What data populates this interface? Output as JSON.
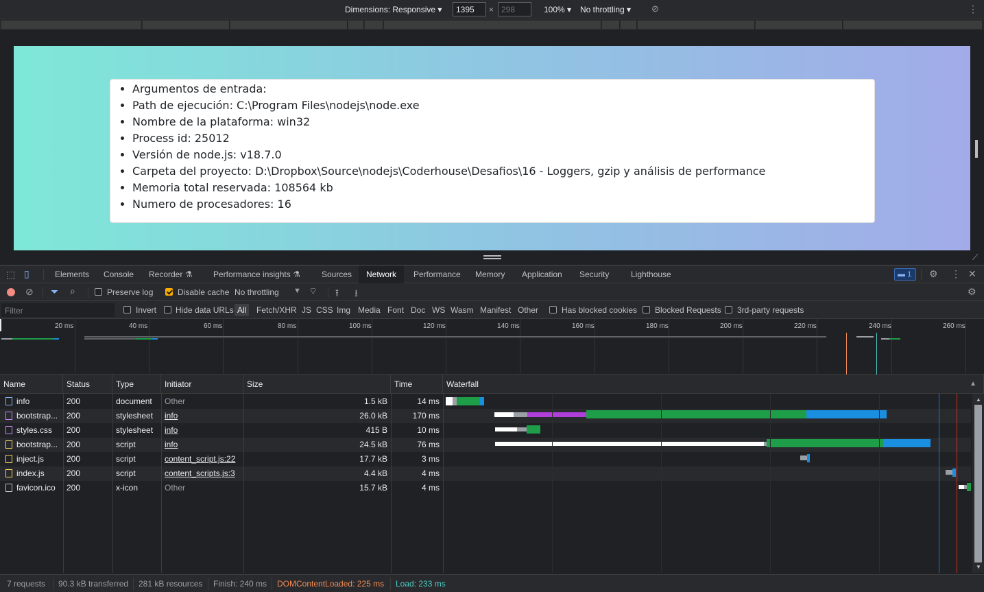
{
  "device_toolbar": {
    "dimensions_label": "Dimensions: Responsive",
    "width": "1395",
    "height_placeholder": "298",
    "times": "×",
    "zoom": "100%",
    "throttling": "No throttling"
  },
  "page": {
    "items": [
      "Argumentos de entrada:",
      "Path de ejecución: C:\\Program Files\\nodejs\\node.exe",
      "Nombre de la plataforma: win32",
      "Process id: 25012",
      "Versión de node.js: v18.7.0",
      "Carpeta del proyecto: D:\\Dropbox\\Source\\nodejs\\Coderhouse\\Desafios\\16 - Loggers, gzip y análisis de performance",
      "Memoria total reservada: 108564 kb",
      "Numero de procesadores: 16"
    ]
  },
  "devtools_tabs": {
    "elements": "Elements",
    "console": "Console",
    "recorder": "Recorder",
    "perf_insights": "Performance insights",
    "sources": "Sources",
    "network": "Network",
    "performance": "Performance",
    "memory": "Memory",
    "application": "Application",
    "security": "Security",
    "lighthouse": "Lighthouse",
    "issues_count": "1"
  },
  "network_toolbar": {
    "preserve_log": "Preserve log",
    "disable_cache": "Disable cache",
    "throttling": "No throttling"
  },
  "filter_bar": {
    "filter_placeholder": "Filter",
    "invert": "Invert",
    "hide_data_urls": "Hide data URLs",
    "types": [
      "All",
      "Fetch/XHR",
      "JS",
      "CSS",
      "Img",
      "Media",
      "Font",
      "Doc",
      "WS",
      "Wasm",
      "Manifest",
      "Other"
    ],
    "has_blocked_cookies": "Has blocked cookies",
    "blocked_requests": "Blocked Requests",
    "third_party": "3rd-party requests"
  },
  "overview_ticks": [
    "20 ms",
    "40 ms",
    "60 ms",
    "80 ms",
    "100 ms",
    "120 ms",
    "140 ms",
    "160 ms",
    "180 ms",
    "200 ms",
    "220 ms",
    "240 ms",
    "260 ms"
  ],
  "table": {
    "headers": {
      "name": "Name",
      "status": "Status",
      "type": "Type",
      "initiator": "Initiator",
      "size": "Size",
      "time": "Time",
      "waterfall": "Waterfall"
    },
    "rows": [
      {
        "name": "info",
        "status": "200",
        "type": "document",
        "initiator": "Other",
        "size": "1.5 kB",
        "time": "14 ms",
        "icon": "document-icon",
        "color": "#8ab4f8"
      },
      {
        "name": "bootstrap...",
        "status": "200",
        "type": "stylesheet",
        "initiator": "info",
        "size": "26.0 kB",
        "time": "170 ms",
        "icon": "stylesheet-icon",
        "color": "#c58af9"
      },
      {
        "name": "styles.css",
        "status": "200",
        "type": "stylesheet",
        "initiator": "info",
        "size": "415 B",
        "time": "10 ms",
        "icon": "stylesheet-icon",
        "color": "#c58af9"
      },
      {
        "name": "bootstrap...",
        "status": "200",
        "type": "script",
        "initiator": "info",
        "size": "24.5 kB",
        "time": "76 ms",
        "icon": "script-icon",
        "color": "#fdd663"
      },
      {
        "name": "inject.js",
        "status": "200",
        "type": "script",
        "initiator": "content_script.js:22",
        "size": "17.7 kB",
        "time": "3 ms",
        "icon": "script-icon",
        "color": "#fdd663"
      },
      {
        "name": "index.js",
        "status": "200",
        "type": "script",
        "initiator": "content_scripts.js:3",
        "size": "4.4 kB",
        "time": "4 ms",
        "icon": "script-icon",
        "color": "#fdd663"
      },
      {
        "name": "favicon.ico",
        "status": "200",
        "type": "x-icon",
        "initiator": "Other",
        "size": "15.7 kB",
        "time": "4 ms",
        "icon": "file-icon",
        "color": "#bdc1c6"
      }
    ]
  },
  "status_bar": {
    "requests": "7 requests",
    "transferred": "90.3 kB transferred",
    "resources": "281 kB resources",
    "finish": "Finish: 240 ms",
    "dom_content_loaded": "DOMContentLoaded: 225 ms",
    "load": "Load: 233 ms"
  },
  "colors": {
    "dcl": "#f28b54",
    "load": "#4ecdc4",
    "waiting": "#1e9e48",
    "download": "#1a8fe0",
    "ssl": "#b03fd9",
    "accent": "#f9ab00"
  }
}
